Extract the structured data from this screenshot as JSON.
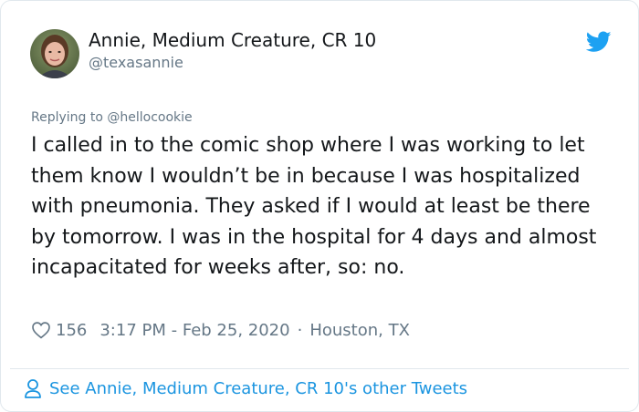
{
  "author": {
    "display_name": "Annie, Medium Creature, CR 10",
    "handle": "@texasannie",
    "avatar_icon": "avatar-photo"
  },
  "reply": {
    "prefix": "Replying to ",
    "mention": "@hellocookie"
  },
  "tweet": {
    "text": "I called in to the comic shop where I was working to let them know I wouldn’t be in because I was hospitalized with pneumonia. They asked if I would at least be there by tomorrow. I was in the hospital for 4 days and almost incapacitated for weeks after, so: no."
  },
  "meta": {
    "likes": "156",
    "timestamp": "3:17 PM - Feb 25, 2020",
    "separator": "·",
    "location": "Houston, TX"
  },
  "footer": {
    "see_more_label": "See Annie, Medium Creature, CR 10's other Tweets"
  },
  "colors": {
    "twitter_blue": "#1da1f2",
    "link_blue": "#1b95e0",
    "secondary_text": "#657786"
  }
}
